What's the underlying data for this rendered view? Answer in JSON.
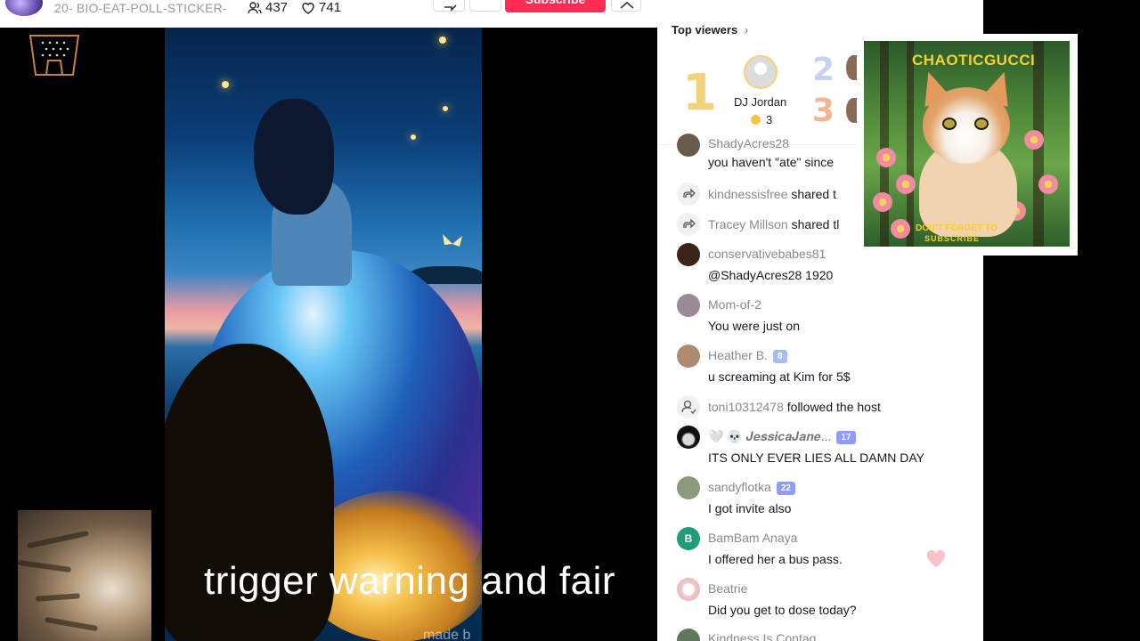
{
  "header": {
    "title": "20- BIO-EAT-POLL-STICKER-",
    "viewer_count": "437",
    "like_count": "741",
    "subscribe_label": "Subscribe"
  },
  "video": {
    "watermark": "made b"
  },
  "caption": "trigger warning and fair",
  "top_viewers": {
    "heading": "Top viewers",
    "chevron": "›",
    "rank1": "1",
    "rank2": "2",
    "rank3": "3",
    "first_name": "DJ Jordan",
    "first_coins": "3"
  },
  "chat": [
    {
      "user": "ShadyAcres28",
      "text": "you haven't \"ate\" since"
    },
    {
      "user": "kindnessisfree",
      "action": "shared t"
    },
    {
      "user": "Tracey Millson",
      "action": "shared tl"
    },
    {
      "user": "conservativebabes81",
      "text": "@ShadyAcres28 1920"
    },
    {
      "user": "Mom-of-2",
      "text": "You were just on"
    },
    {
      "user": "Heather B.",
      "badge": "8",
      "text": "u screaming at Kim for 5$"
    },
    {
      "user": "toni10312478",
      "action": "followed the host"
    },
    {
      "user": "🤍 💀 𝑱𝒆𝒔𝒔𝒊𝒄𝒂𝑱𝒂𝒏𝒆...",
      "badge": "17",
      "text": "ITS ONLY EVER LIES ALL DAMN DAY"
    },
    {
      "user": "sandyflotka",
      "badge": "22",
      "text": "I got invite also"
    },
    {
      "user": "BamBam Anaya",
      "avatar_letter": "B",
      "text": "I offered her a bus pass."
    },
    {
      "user": "Beatrie",
      "text": "Did you get to dose today?"
    },
    {
      "user": "Kindness Is Contag"
    }
  ],
  "ad": {
    "brand": "CHAOTICGUCCI",
    "line1": "DON'T FORGET TO",
    "line2": "SUBSCRIBE"
  },
  "colors": {
    "accent": "#fe2c55",
    "badge": "#8f9cff",
    "rank1": "#f2d27a",
    "caption": "#ffffff"
  }
}
